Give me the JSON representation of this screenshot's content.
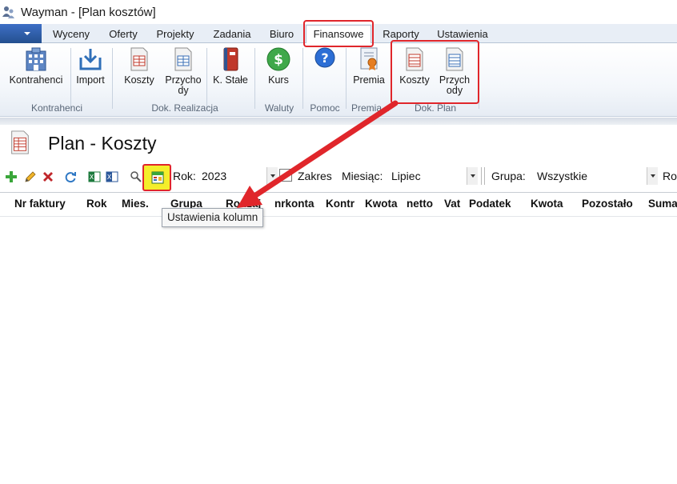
{
  "window": {
    "title": "Wayman - [Plan kosztów]"
  },
  "tabs": [
    "Wyceny",
    "Oferty",
    "Projekty",
    "Zadania",
    "Biuro",
    "Finansowe",
    "Raporty",
    "Ustawienia"
  ],
  "active_tab": "Finansowe",
  "ribbon": {
    "buttons": {
      "kontrahenci": "Kontrahenci",
      "import": "Import",
      "koszty": "Koszty",
      "przychody_l1": "Przycho",
      "przychody_l2": "dy",
      "k_stale": "K. Stałe",
      "kurs": "Kurs",
      "premia": "Premia",
      "plan_koszty": "Koszty",
      "plan_przychody_l1": "Przych",
      "plan_przychody_l2": "ody"
    },
    "groups": {
      "kontrahenci": "Kontrahenci",
      "dok_realizacja": "Dok. Realizacja",
      "waluty": "Waluty",
      "pomoc": "Pomoc",
      "premia": "Premia...",
      "dok_plan": "Dok. Plan"
    }
  },
  "page": {
    "title": "Plan - Koszty"
  },
  "toolbar": {
    "rok_label": "Rok:",
    "rok_value": "2023",
    "zakres_label": "Zakres",
    "miesiac_label": "Miesiąc:",
    "miesiac_value": "Lipiec",
    "grupa_label": "Grupa:",
    "grupa_value": "Wszystkie",
    "cut_label": "Ro"
  },
  "columns": [
    "Nr faktury",
    "Rok",
    "Mies.",
    "Grupa",
    "Rodzaj",
    "nrkonta",
    "Kontr",
    "Kwota",
    "netto",
    "Vat",
    "Podatek",
    "Kwota",
    "Pozostało",
    "Suma"
  ],
  "tooltip": "Ustawienia kolumn",
  "colors": {
    "annotation_red": "#e0262b",
    "highlight_yellow": "#f4ee2b",
    "ribbon_accent": "#2b579a"
  }
}
